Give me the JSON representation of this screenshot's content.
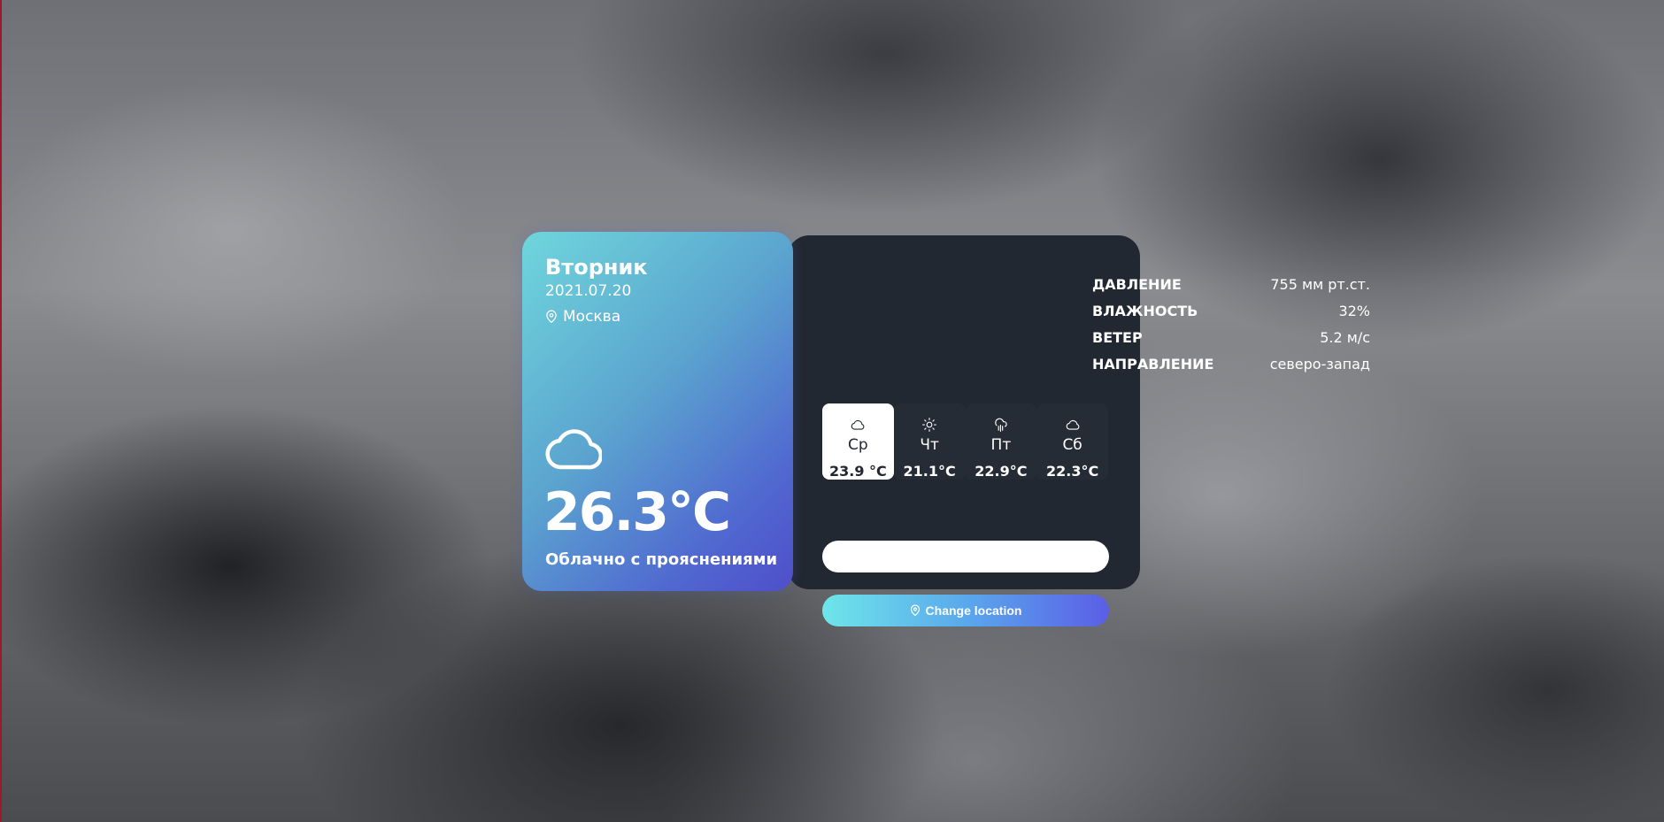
{
  "current": {
    "day_name": "Вторник",
    "date": "2021.07.20",
    "city": "Москва",
    "temperature": "26.3°C",
    "description": "Облачно с прояснениями",
    "icon": "cloud-icon"
  },
  "stats": [
    {
      "label": "ДАВЛЕНИЕ",
      "value": "755 мм рт.ст."
    },
    {
      "label": "ВЛАЖНОСТЬ",
      "value": "32%"
    },
    {
      "label": "ВЕТЕР",
      "value": "5.2 м/с"
    },
    {
      "label": "НАПРАВЛЕНИЕ",
      "value": "северо-запад"
    }
  ],
  "forecast": [
    {
      "day": "Ср",
      "temp": "23.9 °C",
      "icon": "cloud-icon",
      "selected": true
    },
    {
      "day": "Чт",
      "temp": "21.1°C",
      "icon": "sun-icon",
      "selected": false
    },
    {
      "day": "Пт",
      "temp": "22.9°C",
      "icon": "cloud-rain-icon",
      "selected": false
    },
    {
      "day": "Сб",
      "temp": "22.3°C",
      "icon": "cloud-icon",
      "selected": false
    }
  ],
  "search": {
    "value": "",
    "placeholder": ""
  },
  "change_location": {
    "label": "Change location",
    "icon": "map-pin-icon"
  },
  "colors": {
    "panel_bg": "#222831",
    "card_gradient_start": "#6fd6dc",
    "card_gradient_end": "#4f4fc9",
    "button_gradient_start": "#6ee6ea",
    "button_gradient_end": "#5b5ee6"
  }
}
